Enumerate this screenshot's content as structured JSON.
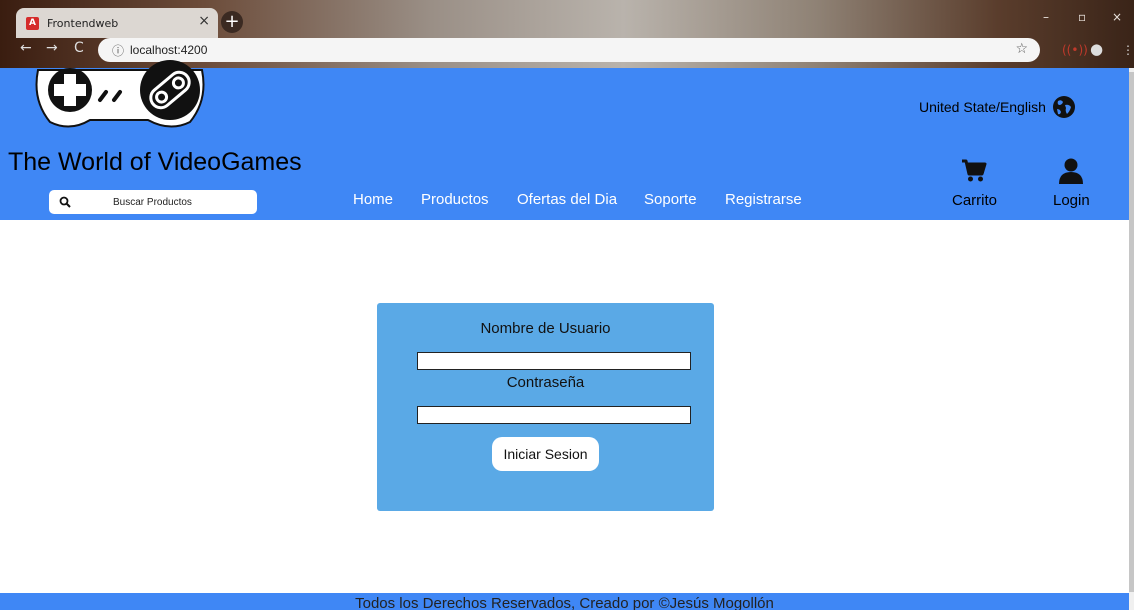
{
  "browser": {
    "tab_title": "Frontendweb",
    "tab_favicon_letter": "A",
    "url_info_icon": "ⓘ",
    "url": "localhost:4200",
    "newtab_symbol": "+",
    "close_symbol": "×",
    "back_symbol": "←",
    "forward_symbol": "→",
    "reload_symbol": "C",
    "bookmark_symbol": "☆",
    "minimize_symbol": "–",
    "maximize_symbol": "▫",
    "window_close_symbol": "×"
  },
  "header": {
    "site_title": "The World of VideoGames",
    "language": "United State/English",
    "search": {
      "placeholder": "Buscar Productos"
    },
    "nav": [
      {
        "label": "Home"
      },
      {
        "label": "Productos"
      },
      {
        "label": "Ofertas del Dia"
      },
      {
        "label": "Soporte"
      },
      {
        "label": "Registrarse"
      }
    ],
    "cart_label": "Carrito",
    "login_label": "Login"
  },
  "login_form": {
    "username_label": "Nombre de Usuario",
    "username_value": "",
    "password_label": "Contraseña",
    "password_value": "",
    "submit_label": "Iniciar Sesion"
  },
  "footer": {
    "text": "Todos los Derechos Reservados, Creado por ©Jesús Mogollón"
  },
  "colors": {
    "header_bg": "#3f87f5",
    "card_bg": "#5aa9e6",
    "nav_text": "#ffffff"
  },
  "icons": [
    "controller-logo-icon",
    "globe-icon",
    "search-icon",
    "cart-icon",
    "user-icon"
  ]
}
